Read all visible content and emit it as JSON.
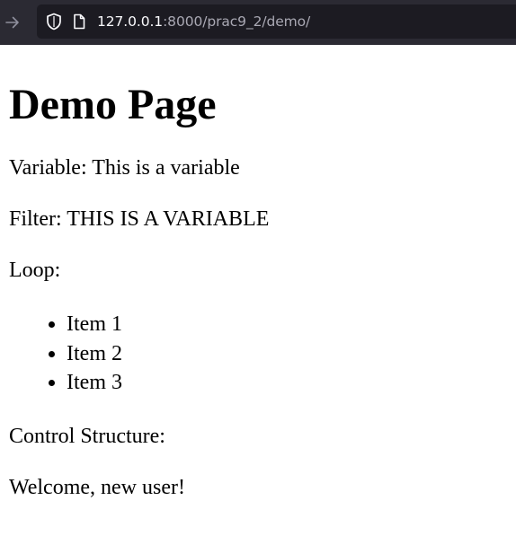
{
  "browser": {
    "url_host": "127.0.0.1",
    "url_rest": ":8000/prac9_2/demo/"
  },
  "page": {
    "title": "Demo Page",
    "variable_line": "Variable: This is a variable",
    "filter_line": "Filter: THIS IS A VARIABLE",
    "loop_label": "Loop:",
    "loop_items": [
      "Item 1",
      "Item 2",
      "Item 3"
    ],
    "control_label": "Control Structure:",
    "welcome_message": "Welcome, new user!"
  },
  "colors": {
    "toolbar_bg": "#2b2a33",
    "urlbar_bg": "#1c1b22",
    "url_host_text": "#fbfbfe",
    "url_path_text": "#a9a8b3"
  },
  "icons": {
    "forward": "arrow-right-icon",
    "tracking_protection": "shield-icon",
    "page_info": "page-icon"
  }
}
